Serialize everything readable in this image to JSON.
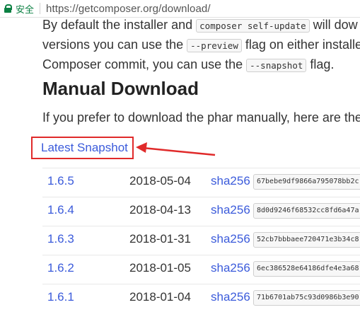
{
  "browser": {
    "secure_label": "安全",
    "url": "https://getcomposer.org/download/"
  },
  "intro": {
    "line1_pre": "By default the installer and ",
    "line1_code": "composer self-update",
    "line1_post": " will dow",
    "line2_pre": "versions you can use the ",
    "line2_code": "--preview",
    "line2_post": " flag on either installer",
    "line3_pre": "Composer commit, you can use the ",
    "line3_code": "--snapshot",
    "line3_post": " flag."
  },
  "heading": "Manual Download",
  "prefer_text": "If you prefer to download the phar manually, here are the a",
  "latest_snapshot": "Latest Snapshot",
  "annotation_color": "#e02a2a",
  "releases": [
    {
      "version": "1.6.5",
      "date": "2018-05-04",
      "sha": "sha256",
      "hash": "67bebe9df9866a795078bb2c"
    },
    {
      "version": "1.6.4",
      "date": "2018-04-13",
      "sha": "sha256",
      "hash": "8d0d9246f68532cc8fd6a47a"
    },
    {
      "version": "1.6.3",
      "date": "2018-01-31",
      "sha": "sha256",
      "hash": "52cb7bbbaee720471e3b34c8"
    },
    {
      "version": "1.6.2",
      "date": "2018-01-05",
      "sha": "sha256",
      "hash": "6ec386528e64186dfe4e3a68"
    },
    {
      "version": "1.6.1",
      "date": "2018-01-04",
      "sha": "sha256",
      "hash": "71b6701ab75c93d0986b3e90"
    }
  ]
}
